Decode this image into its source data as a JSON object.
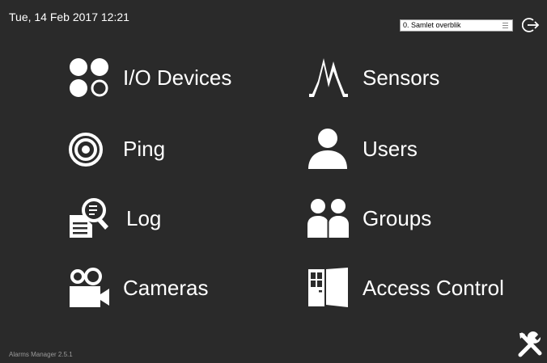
{
  "header": {
    "datetime": "Tue, 14 Feb 2017 12:21",
    "view_select": {
      "value": "0. Samlet overblik"
    }
  },
  "menu": {
    "io_devices": {
      "label": "I/O Devices",
      "icon": "io-devices-icon"
    },
    "sensors": {
      "label": "Sensors",
      "icon": "sensors-icon"
    },
    "ping": {
      "label": "Ping",
      "icon": "ping-icon"
    },
    "users": {
      "label": "Users",
      "icon": "users-icon"
    },
    "log": {
      "label": "Log",
      "icon": "log-icon"
    },
    "groups": {
      "label": "Groups",
      "icon": "groups-icon"
    },
    "cameras": {
      "label": "Cameras",
      "icon": "cameras-icon"
    },
    "access_control": {
      "label": "Access Control",
      "icon": "access-control-icon"
    }
  },
  "footer": {
    "version": "Alarms Manager 2.5.1"
  },
  "colors": {
    "background": "#2a2a2a",
    "foreground": "#ffffff",
    "muted": "#9a9a9a"
  }
}
